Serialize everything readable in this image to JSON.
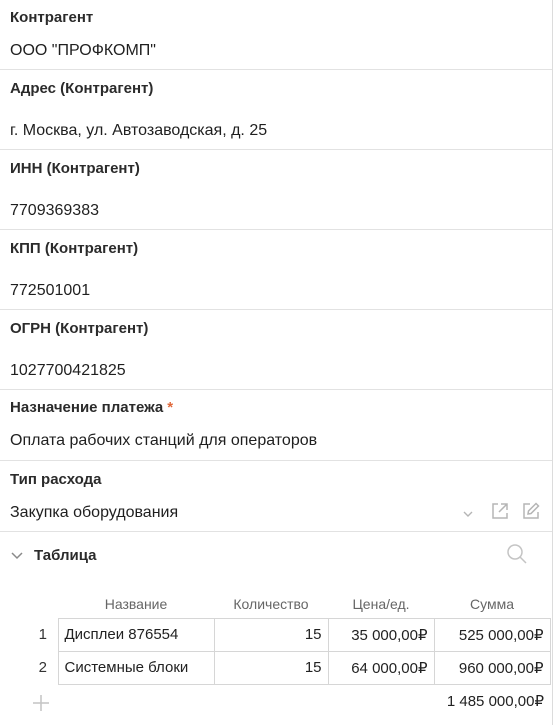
{
  "fields": [
    {
      "label": "Контрагент",
      "value": "ООО \"ПРОФКОМП\""
    },
    {
      "label": "Адрес (Контрагент)",
      "value": "г. Москва, ул. Автозаводская, д. 25"
    },
    {
      "label": "ИНН (Контрагент)",
      "value": "7709369383"
    },
    {
      "label": "КПП (Контрагент)",
      "value": "772501001"
    },
    {
      "label": "ОГРН (Контрагент)",
      "value": "1027700421825"
    },
    {
      "label": "Назначение платежа",
      "required_mark": "*",
      "value": "Оплата рабочих станций для операторов"
    },
    {
      "label": "Тип расхода",
      "value": "Закупка оборудования",
      "icons": [
        "chevron-down-icon",
        "open-external-icon",
        "edit-icon"
      ]
    }
  ],
  "table_section": {
    "title": "Таблица",
    "icons": [
      "chevron-down-icon",
      "search-icon",
      "add-icon"
    ],
    "columns": [
      "Название",
      "Количество",
      "Цена/ед.",
      "Сумма"
    ],
    "rows": [
      {
        "num": "1",
        "name": "Дисплеи 876554",
        "qty": "15",
        "price": "35 000,00₽",
        "sum": "525 000,00₽"
      },
      {
        "num": "2",
        "name": "Системные блоки",
        "qty": "15",
        "price": "64 000,00₽",
        "sum": "960 000,00₽"
      }
    ],
    "total": "1 485 000,00₽"
  },
  "colors": {
    "required": "#e0683a",
    "border": "#e2e2e2",
    "icon": "#b5b5b5"
  }
}
